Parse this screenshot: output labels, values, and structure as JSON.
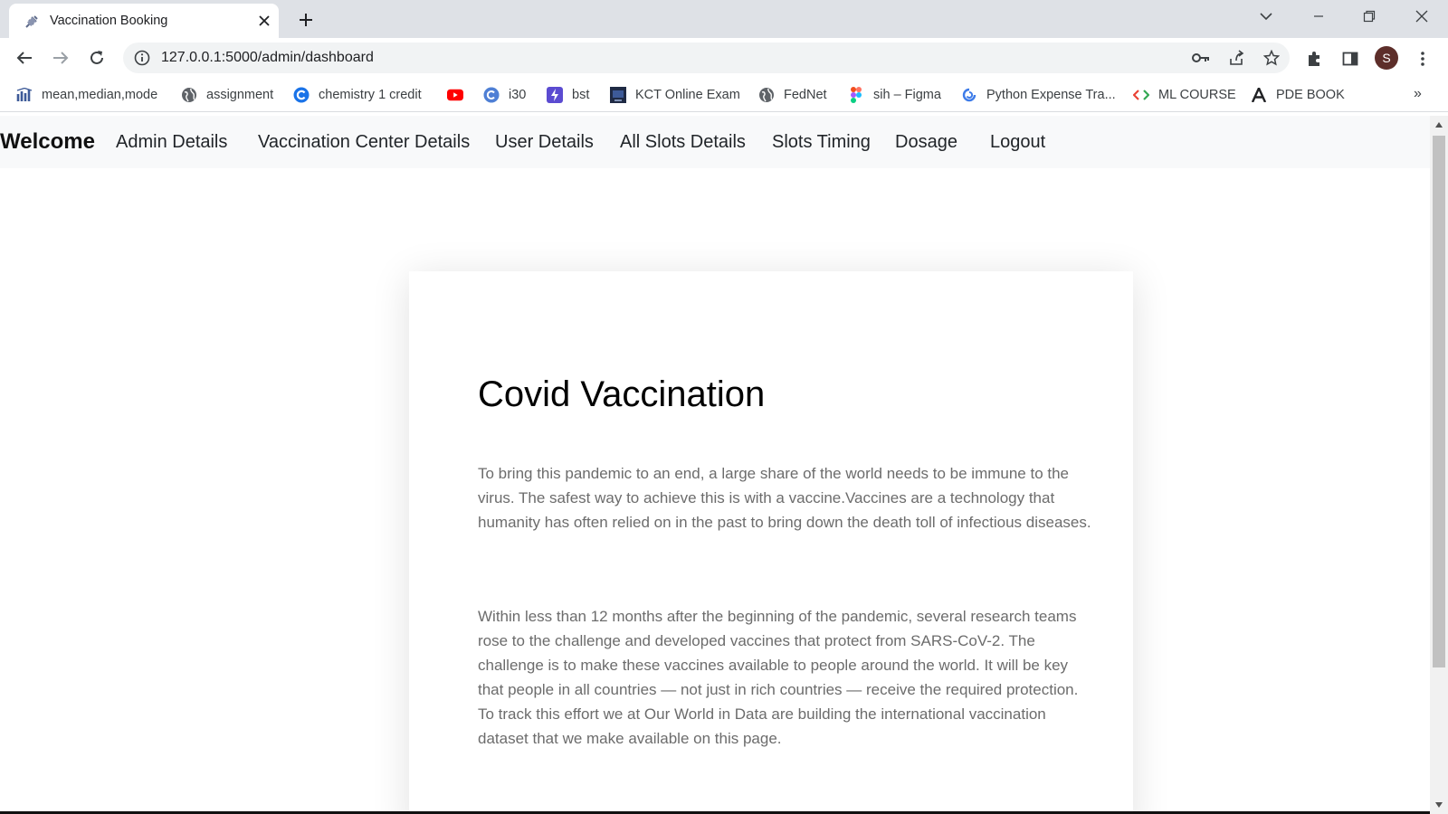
{
  "browser": {
    "tab_title": "Vaccination Booking",
    "url": "127.0.0.1:5000/admin/dashboard",
    "profile_initial": "S",
    "accent_color": "#1a73e8",
    "bookmarks": [
      {
        "label": "mean,median,mode",
        "icon": "chart-bars-icon"
      },
      {
        "label": "assignment",
        "icon": "globe-icon"
      },
      {
        "label": "chemistry 1 credit",
        "icon": "c-circle-icon"
      },
      {
        "label": "",
        "icon": "youtube-icon"
      },
      {
        "label": "i30",
        "icon": "canva-icon"
      },
      {
        "label": "bst",
        "icon": "bolt-icon"
      },
      {
        "label": "KCT Online Exam",
        "icon": "monitor-icon"
      },
      {
        "label": "FedNet",
        "icon": "globe-icon"
      },
      {
        "label": "sih – Figma",
        "icon": "figma-icon"
      },
      {
        "label": "Python Expense Tra...",
        "icon": "refresh-circle-icon"
      },
      {
        "label": "ML COURSE",
        "icon": "code-icon"
      },
      {
        "label": "PDE BOOK",
        "icon": "letter-a-icon"
      }
    ]
  },
  "navbar": {
    "brand": "Welcome",
    "links": [
      "Admin Details",
      "Vaccination Center Details",
      "User Details",
      "All Slots Details",
      "Slots Timing",
      "Dosage",
      "Logout"
    ]
  },
  "content": {
    "title": "Covid Vaccination",
    "paragraph1": "To bring this pandemic to an end, a large share of the world needs to be immune to the virus. The safest way to achieve this is with a vaccine.Vaccines are a technology that humanity has often relied on in the past to bring down the death toll of infectious diseases.",
    "paragraph2": "Within less than 12 months after the beginning of the pandemic, several research teams rose to the challenge and developed vaccines that protect from SARS-CoV-2. The challenge is to make these vaccines available to people around the world. It will be key that people in all countries — not just in rich countries — receive the required protection. To track this effort we at Our World in Data are building the international vaccination dataset that we make available on this page."
  }
}
